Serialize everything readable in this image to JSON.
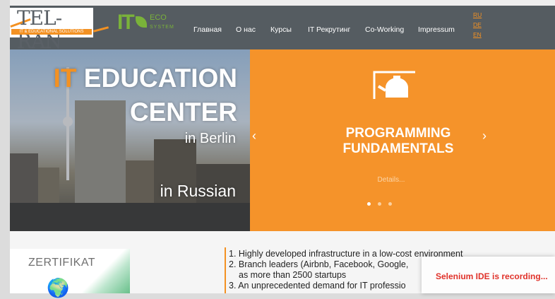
{
  "header": {
    "logo_telran": "TEL-RAN",
    "logo_telran_sub": "IT & EDUCATIONAL SOLUTIONS",
    "logo_eco_it": "IT",
    "logo_eco_word": "ECO",
    "logo_eco_sub": "SYSTEM",
    "nav": [
      "Главная",
      "О нас",
      "Курсы",
      "IT Рекрутинг",
      "Co-Working",
      "Impressum"
    ],
    "languages": [
      "RU",
      "DE",
      "EN"
    ]
  },
  "hero": {
    "headline_it": "IT",
    "headline_education": "EDUCATION",
    "headline_center": "CENTER",
    "in_berlin": "in Berlin",
    "in_russian": "in Russian"
  },
  "slider": {
    "title_line1": "PROGRAMMING",
    "title_line2": "FUNDAMENTALS",
    "details_label": "Details...",
    "prev_arrow": "‹",
    "next_arrow": "›",
    "dots": 3,
    "active_dot": 0
  },
  "certificate": {
    "label": "ZERTIFIKAT"
  },
  "features": [
    "1. Highly developed infrastructure in a low-cost environment",
    "2. Branch leaders (Airbnb, Facebook, Google,",
    "    as more than 2500 startups",
    "3. An unprecedented demand for IT professio"
  ],
  "overlay": {
    "selenium_label": "Selenium IDE is recording..."
  },
  "colors": {
    "accent_orange": "#f5932a",
    "header_gray": "#555c61",
    "eco_green": "#7ab23a",
    "recording_red": "#e0322a"
  }
}
